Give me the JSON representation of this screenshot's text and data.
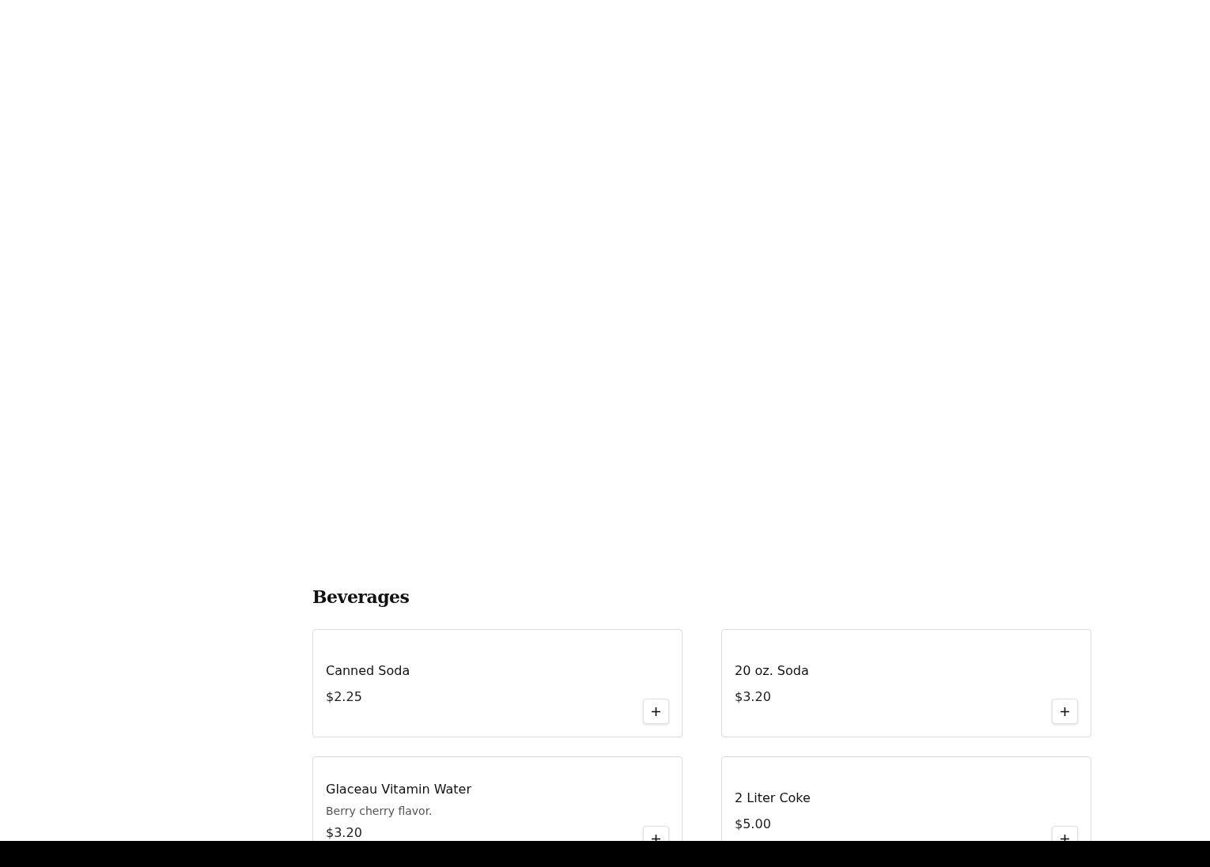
{
  "section": {
    "title": "Beverages"
  },
  "items": [
    {
      "name": "Canned Soda",
      "price": "$2.25"
    },
    {
      "name": "20 oz. Soda",
      "price": "$3.20"
    },
    {
      "name": "Glaceau Vitamin Water",
      "description": "Berry cherry flavor.",
      "price": "$3.20"
    },
    {
      "name": "2 Liter Coke",
      "price": "$5.00"
    }
  ]
}
